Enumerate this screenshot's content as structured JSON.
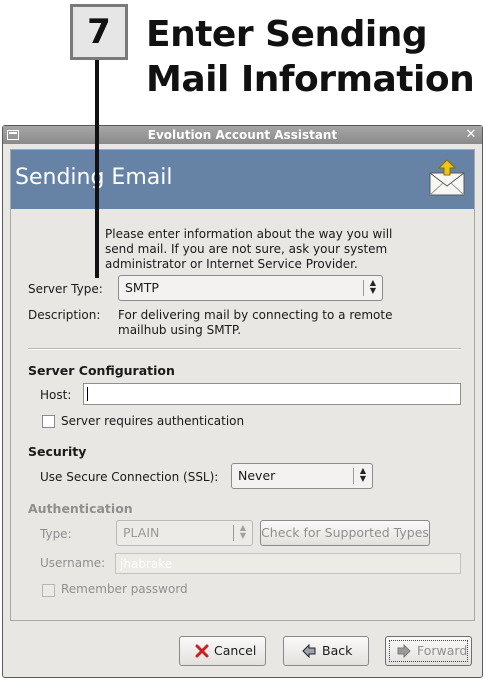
{
  "step": {
    "number": "7",
    "title_line1": "Enter Sending",
    "title_line2": "Mail Information"
  },
  "window": {
    "title": "Evolution Account Assistant",
    "close_glyph": "✕"
  },
  "banner": {
    "title": "Sending Email",
    "icon": "envelope-upload-icon"
  },
  "intro": [
    "Please enter information about the way you will",
    "send mail. If you are not sure, ask your system",
    "administrator or Internet Service Provider."
  ],
  "server_type": {
    "label": "Server Type:",
    "value": "SMTP"
  },
  "description": {
    "label": "Description:",
    "lines": [
      "For delivering mail by connecting to a remote",
      "mailhub using SMTP."
    ]
  },
  "server_config": {
    "heading": "Server Configuration",
    "host_label": "Host:",
    "host_value": "",
    "auth_required_label": "Server requires authentication",
    "auth_required_checked": false
  },
  "security": {
    "heading": "Security",
    "ssl_label": "Use Secure Connection (SSL):",
    "ssl_value": "Never"
  },
  "authentication": {
    "heading": "Authentication",
    "type_label": "Type:",
    "type_value": "PLAIN",
    "check_button": "Check for Supported Types",
    "username_label": "Username:",
    "username_value": "jhabrake",
    "remember_label": "Remember password",
    "remember_checked": false
  },
  "buttons": {
    "cancel": "Cancel",
    "back": "Back",
    "forward": "Forward"
  },
  "colors": {
    "banner": "#6683a6",
    "titlebar": "#8a8a8a",
    "window_bg": "#e9e7e3",
    "cancel_icon": "#cc2020"
  }
}
